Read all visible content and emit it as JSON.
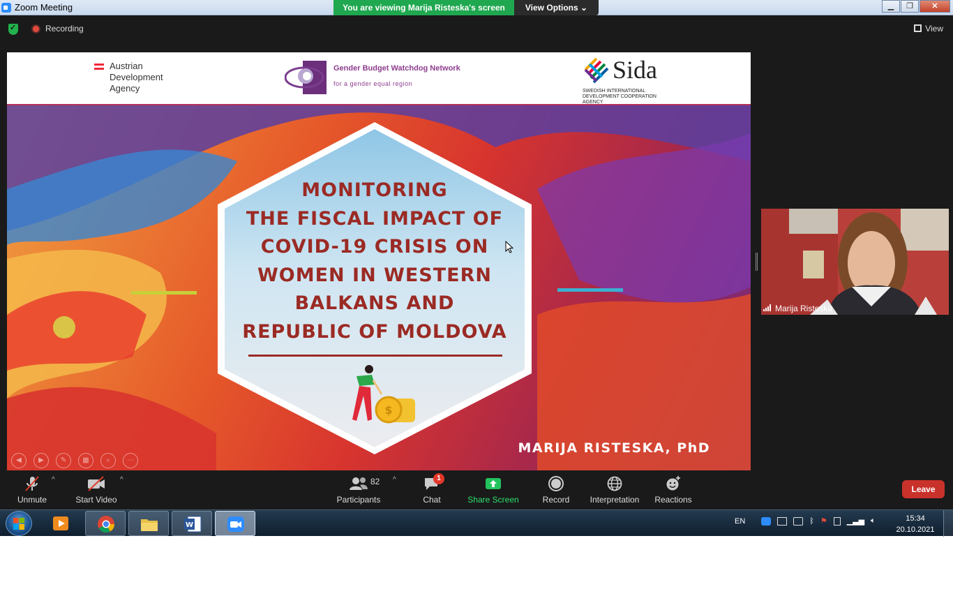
{
  "window": {
    "title": "Zoom Meeting",
    "banner": "You are viewing Marija Risteska's screen",
    "view_options": "View Options",
    "controls": {
      "minimize": "▁",
      "restore": "❐",
      "close": "✕"
    }
  },
  "meeting_top": {
    "recording_label": "Recording",
    "view_label": "View"
  },
  "slide": {
    "header": {
      "ada_name": "Austrian Development Agency",
      "gbwn_title": "Gender Budget Watchdog Network",
      "gbwn_subtitle": "for a gender equal region",
      "sida_name": "Sida",
      "sida_subtitle": "SWEDISH INTERNATIONAL DEVELOPMENT COOPERATION AGENCY"
    },
    "title_lines": [
      "MONITORING",
      "THE FISCAL IMPACT OF",
      "COVID-19 CRISIS ON",
      "WOMEN IN WESTERN",
      "BALKANS AND",
      "REPUBLIC OF MOLDOVA"
    ],
    "author": "MARIJA RISTESKA, PhD",
    "colors": {
      "title": "#9b2a24",
      "accent_purple": "#6a2a86",
      "accent_red": "#d7342e"
    }
  },
  "video": {
    "participant_name": "Marija Risteska"
  },
  "toolbar": {
    "unmute": "Unmute",
    "start_video": "Start Video",
    "participants": "Participants",
    "participants_count": "82",
    "chat": "Chat",
    "chat_badge": "1",
    "share_screen": "Share Screen",
    "record": "Record",
    "interpretation": "Interpretation",
    "reactions": "Reactions",
    "leave": "Leave",
    "caret": "^"
  },
  "taskbar": {
    "language": "EN",
    "time": "15:34",
    "date": "20.10.2021"
  }
}
